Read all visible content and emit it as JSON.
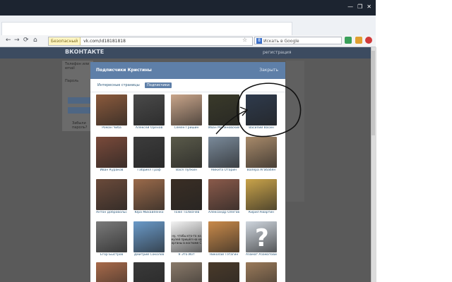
{
  "browser": {
    "window_controls": [
      "—",
      "❐",
      "✕"
    ],
    "nav_buttons": [
      "←",
      "→",
      "⟳",
      "⌂"
    ],
    "lock_label": "Безопасный",
    "url": "vk.com/id18181818",
    "star": "☆",
    "search_engine": "8",
    "search_placeholder": "Искать в Google"
  },
  "vk": {
    "logo": "ВКОНТАКТЕ",
    "header_right": "регистрация",
    "left_labels": [
      "Телефон или email",
      "Пароль"
    ],
    "left_footer": "Забыли пароль?"
  },
  "modal": {
    "title": "Подписчики Кристины",
    "close": "Закрыть",
    "tabs": [
      {
        "label": "Интересные страницы",
        "active": false
      },
      {
        "label": "Подписчики",
        "active": true
      }
    ],
    "people": [
      {
        "name": "Роман Чиба",
        "color": "#8b5a3c"
      },
      {
        "name": "Алексей Орехов",
        "color": "#4a4a4a"
      },
      {
        "name": "Семён Гришин",
        "color": "#c9a58a"
      },
      {
        "name": "Иван Малиновский",
        "color": "#3a3a2a"
      },
      {
        "name": "Василий Васин",
        "color": "#2e3a4c"
      },
      {
        "name": "Иван Кураков",
        "color": "#7a4a3a"
      },
      {
        "name": "Габриел Граф",
        "color": "#3c3c3c"
      },
      {
        "name": "Вася Пупкин",
        "color": "#5a5a4a"
      },
      {
        "name": "Никита Отарин",
        "color": "#7a8a9a"
      },
      {
        "name": "Валера Агабабян",
        "color": "#a88a6a"
      },
      {
        "name": "Антон Добровольский",
        "color": "#6a4a3a"
      },
      {
        "name": "Юра Михайленко",
        "color": "#9a6a4a"
      },
      {
        "name": "Тоже Толмачёв",
        "color": "#3a2e24"
      },
      {
        "name": "Александр Олегович",
        "color": "#8a5a4a"
      },
      {
        "name": "Кирил Квартин",
        "color": "#c9a34a"
      },
      {
        "name": "Егор Быстров",
        "color": "#7a7a7a"
      },
      {
        "name": "Дмитрий Соколов",
        "color": "#6a9ac9"
      },
      {
        "name": "Я Это Иот",
        "color": "#f4f4f4"
      },
      {
        "name": "Николай Тэтагин",
        "color": "#c98a4a"
      },
      {
        "name": "Азамат Азаматович",
        "color": "#cfd6de"
      },
      {
        "name": "",
        "color": "#a86a4a"
      },
      {
        "name": "",
        "color": "#3a3a3a"
      },
      {
        "name": "",
        "color": "#8a7a6a"
      },
      {
        "name": "",
        "color": "#4a3a2a"
      },
      {
        "name": "",
        "color": "#9a7a5a"
      }
    ],
    "caption_on_image": "ну, чтобы кто-то на музей пришёл на на органы в костюме С"
  },
  "colors": {
    "vk_blue": "#5e7fa8",
    "link": "#2b587a",
    "titlebar": "#1c2430"
  }
}
